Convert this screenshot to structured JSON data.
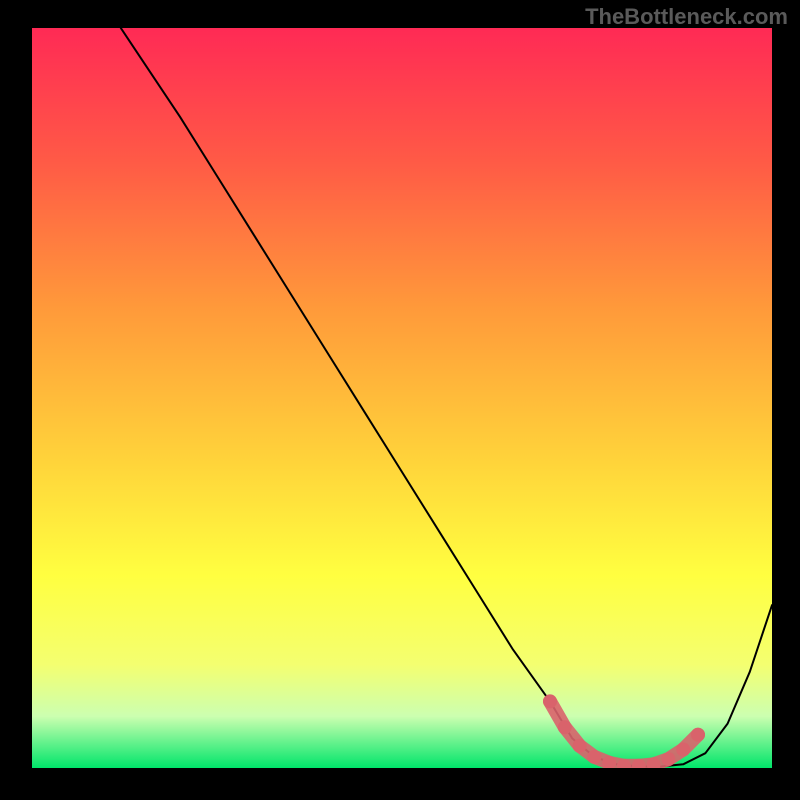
{
  "watermark": "TheBottleneck.com",
  "chart_data": {
    "type": "line",
    "title": "",
    "xlabel": "",
    "ylabel": "",
    "xlim": [
      0,
      100
    ],
    "ylim": [
      0,
      100
    ],
    "grid": false,
    "background_gradient_stops": [
      {
        "offset": 0,
        "color": "#ff2a55"
      },
      {
        "offset": 18,
        "color": "#ff5a46"
      },
      {
        "offset": 38,
        "color": "#ff9a3a"
      },
      {
        "offset": 58,
        "color": "#ffd23a"
      },
      {
        "offset": 74,
        "color": "#ffff40"
      },
      {
        "offset": 86,
        "color": "#f4ff70"
      },
      {
        "offset": 93,
        "color": "#ccffb0"
      },
      {
        "offset": 100,
        "color": "#00e56a"
      }
    ],
    "series": [
      {
        "name": "bottleneck-curve",
        "color": "#000000",
        "x": [
          12,
          16,
          20,
          25,
          30,
          35,
          40,
          45,
          50,
          55,
          60,
          65,
          70,
          73,
          76,
          79,
          82,
          85,
          88,
          91,
          94,
          97,
          100
        ],
        "y": [
          100,
          94,
          88,
          80,
          72,
          64,
          56,
          48,
          40,
          32,
          24,
          16,
          9,
          4,
          1.5,
          0.5,
          0.2,
          0.2,
          0.5,
          2,
          6,
          13,
          22
        ]
      }
    ],
    "highlight": {
      "name": "optimal-region",
      "color": "#d9636b",
      "style": "dotted-thick",
      "x": [
        70,
        72,
        74,
        76,
        78,
        80,
        82,
        84,
        86,
        88,
        90
      ],
      "y": [
        9,
        5.5,
        3,
        1.5,
        0.7,
        0.3,
        0.3,
        0.5,
        1.2,
        2.5,
        4.5
      ]
    }
  }
}
